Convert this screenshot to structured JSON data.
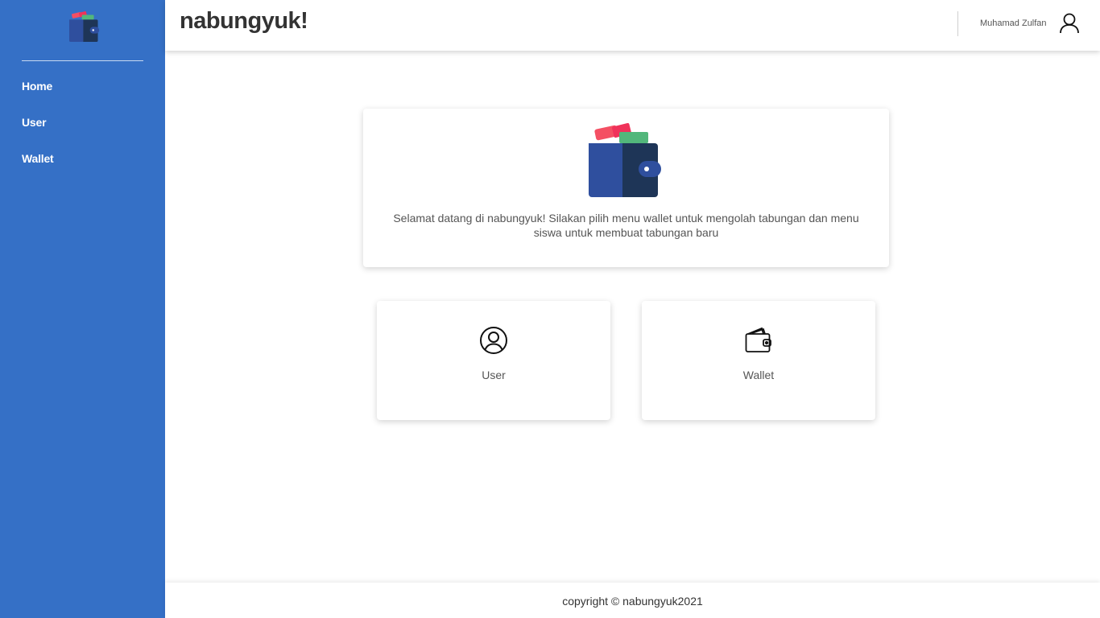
{
  "app": {
    "brand": "nabungyuk!"
  },
  "sidebar": {
    "logo_icon": "wallet-logo-icon",
    "items": [
      {
        "label": "Home"
      },
      {
        "label": "User"
      },
      {
        "label": "Wallet"
      }
    ]
  },
  "header": {
    "user_name": "Muhamad Zulfan",
    "user_icon": "user-icon"
  },
  "welcome": {
    "logo_icon": "wallet-logo-icon",
    "text": "Selamat datang di nabungyuk! Silakan pilih menu wallet untuk mengolah tabungan dan menu siswa untuk membuat tabungan baru"
  },
  "cards": [
    {
      "label": "User",
      "icon": "user-circle-icon"
    },
    {
      "label": "Wallet",
      "icon": "wallet-icon"
    }
  ],
  "footer": {
    "text": "copyright © nabungyuk2021"
  },
  "colors": {
    "sidebar_bg": "#3570c6",
    "wallet_blue": "#2f4f9e",
    "wallet_navy": "#1e3557",
    "wallet_red": "#f44f63",
    "wallet_pink": "#f0325a",
    "wallet_green": "#52b77b"
  }
}
